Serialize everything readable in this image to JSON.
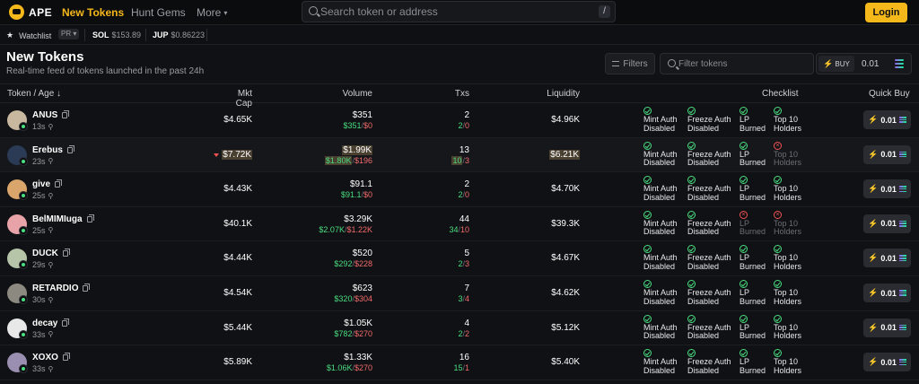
{
  "nav": {
    "brand": "APE",
    "links": [
      "New Tokens",
      "Hunt Gems",
      "More"
    ],
    "search_placeholder": "Search token or address",
    "search_shortcut": "/",
    "login_label": "Login"
  },
  "ticker": {
    "watchlist_label": "Watchlist",
    "pr_label": "PR",
    "sol_label": "SOL",
    "sol_price": "$153.89",
    "jup_label": "JUP",
    "jup_price": "$0.86223"
  },
  "section": {
    "title": "New Tokens",
    "subtitle": "Real-time feed of tokens launched in the past 24h",
    "filters_label": "Filters",
    "filter_placeholder": "Filter tokens",
    "buy_label": "BUY",
    "buy_amount": "0.01"
  },
  "columns": {
    "token": "Token / Age",
    "mcap": "Mkt Cap",
    "volume": "Volume",
    "txs": "Txs",
    "liquidity": "Liquidity",
    "checklist": "Checklist",
    "quick_buy": "Quick Buy"
  },
  "checklist_labels": {
    "mint": [
      "Mint Auth",
      "Disabled"
    ],
    "freeze": [
      "Freeze Auth",
      "Disabled"
    ],
    "lp": [
      "LP",
      "Burned"
    ],
    "top10": [
      "Top 10",
      "Holders"
    ]
  },
  "quick_buy_amount": "0.01",
  "colors": {
    "accent": "#f5b81b",
    "green": "#4ade80",
    "red": "#f26b6b",
    "highlight": "#4a4030"
  },
  "rows": [
    {
      "name": "ANUS",
      "age": "13s",
      "mcap": "$4.65K",
      "vol": "$351",
      "vol_buy": "$351",
      "vol_sell": "$0",
      "txs": "2",
      "txs_buy": "2",
      "txs_sell": "0",
      "liq": "$4.96K",
      "highlight": false,
      "mcap_down": false,
      "checks": [
        true,
        true,
        true,
        true
      ],
      "avatar": "#c9b8a0"
    },
    {
      "name": "Erebus",
      "age": "23s",
      "mcap": "$7.72K",
      "vol": "$1.99K",
      "vol_buy": "$1.80K",
      "vol_sell": "$196",
      "txs": "13",
      "txs_buy": "10",
      "txs_sell": "3",
      "liq": "$6.21K",
      "highlight": true,
      "mcap_down": true,
      "checks": [
        true,
        true,
        true,
        false
      ],
      "avatar": "#2b3a55"
    },
    {
      "name": "give",
      "age": "25s",
      "mcap": "$4.43K",
      "vol": "$91.1",
      "vol_buy": "$91.1",
      "vol_sell": "$0",
      "txs": "2",
      "txs_buy": "2",
      "txs_sell": "0",
      "liq": "$4.70K",
      "highlight": false,
      "mcap_down": false,
      "checks": [
        true,
        true,
        true,
        true
      ],
      "avatar": "#d9a56b"
    },
    {
      "name": "BelMIMIuga",
      "age": "25s",
      "mcap": "$40.1K",
      "vol": "$3.29K",
      "vol_buy": "$2.07K",
      "vol_sell": "$1.22K",
      "txs": "44",
      "txs_buy": "34",
      "txs_sell": "10",
      "liq": "$39.3K",
      "highlight": false,
      "mcap_down": false,
      "checks": [
        true,
        true,
        false,
        false
      ],
      "avatar": "#e7a3a8"
    },
    {
      "name": "DUCK",
      "age": "29s",
      "mcap": "$4.44K",
      "vol": "$520",
      "vol_buy": "$292",
      "vol_sell": "$228",
      "txs": "5",
      "txs_buy": "2",
      "txs_sell": "3",
      "liq": "$4.67K",
      "highlight": false,
      "mcap_down": false,
      "checks": [
        true,
        true,
        true,
        true
      ],
      "avatar": "#b6c4a8"
    },
    {
      "name": "RETARDIO",
      "age": "30s",
      "mcap": "$4.54K",
      "vol": "$623",
      "vol_buy": "$320",
      "vol_sell": "$304",
      "txs": "7",
      "txs_buy": "3",
      "txs_sell": "4",
      "liq": "$4.62K",
      "highlight": false,
      "mcap_down": false,
      "checks": [
        true,
        true,
        true,
        true
      ],
      "avatar": "#8c8a80"
    },
    {
      "name": "decay",
      "age": "33s",
      "mcap": "$5.44K",
      "vol": "$1.05K",
      "vol_buy": "$782",
      "vol_sell": "$270",
      "txs": "4",
      "txs_buy": "2",
      "txs_sell": "2",
      "liq": "$5.12K",
      "highlight": false,
      "mcap_down": false,
      "checks": [
        true,
        true,
        true,
        true
      ],
      "avatar": "#e8e8e8"
    },
    {
      "name": "XOXO",
      "age": "33s",
      "mcap": "$5.89K",
      "vol": "$1.33K",
      "vol_buy": "$1.06K",
      "vol_sell": "$270",
      "txs": "16",
      "txs_buy": "15",
      "txs_sell": "1",
      "liq": "$5.40K",
      "highlight": false,
      "mcap_down": false,
      "checks": [
        true,
        true,
        true,
        true
      ],
      "avatar": "#9a8fb0"
    }
  ]
}
